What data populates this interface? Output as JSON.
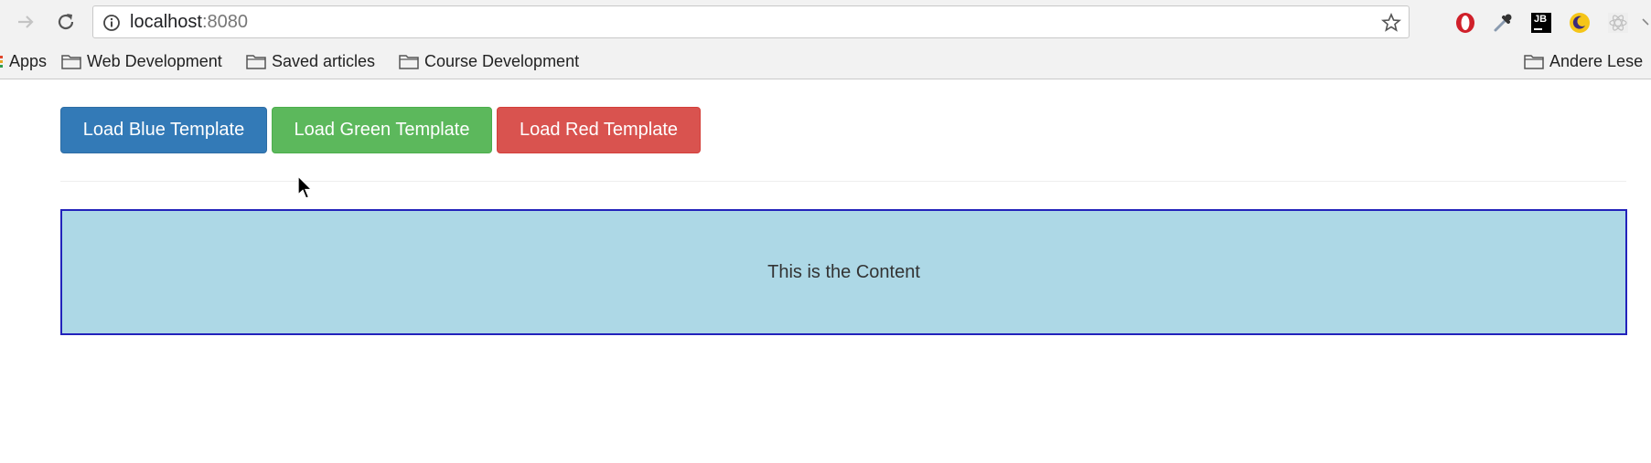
{
  "browser": {
    "url_host": "localhost",
    "url_port": ":8080",
    "bookmarks": {
      "apps": "Apps",
      "items": [
        "Web Development",
        "Saved articles",
        "Course Development"
      ],
      "other": "Andere Lese"
    },
    "extensions": {
      "jb_label": "JB"
    }
  },
  "page": {
    "buttons": {
      "blue": "Load Blue Template",
      "green": "Load Green Template",
      "red": "Load Red Template"
    },
    "content_text": "This is the Content"
  },
  "colors": {
    "blue_button": "#337ab7",
    "green_button": "#5cb85c",
    "red_button": "#d9534f",
    "content_bg": "#add8e6",
    "content_border": "#2222bb"
  }
}
